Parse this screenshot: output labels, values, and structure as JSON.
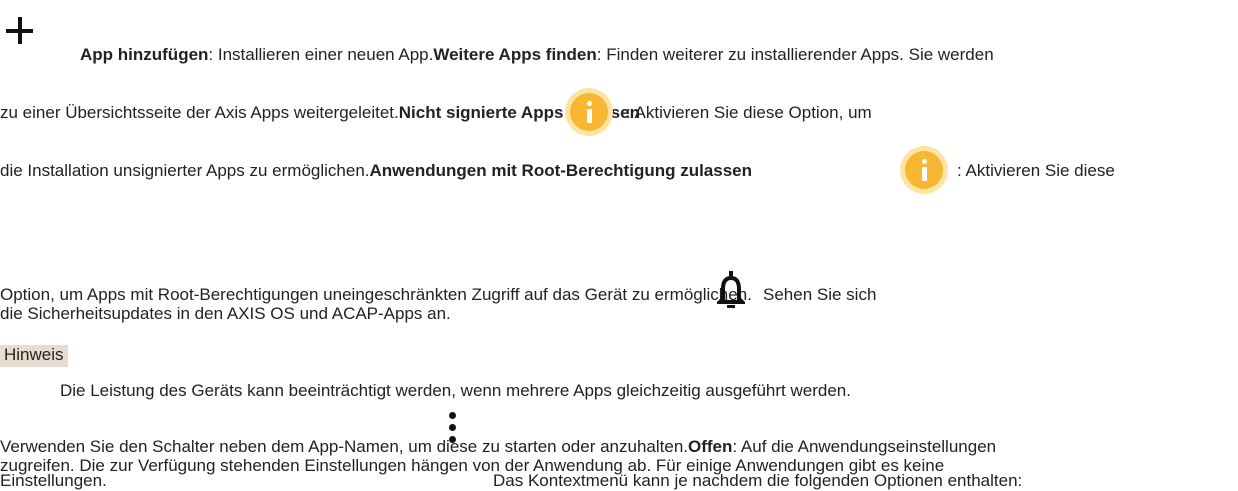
{
  "add_app": {
    "icon": "plus-icon",
    "label": "App hinzufügen",
    "desc": ": Installieren einer neuen App."
  },
  "find_apps": {
    "label": "Weitere Apps finden",
    "desc_line1": ": Finden weiterer zu installierender Apps. Sie werden",
    "desc_line2": "zu einer Übersichtsseite der Axis Apps weitergeleitet."
  },
  "unsigned_apps": {
    "label": "Nicht signierte Apps zulassen",
    "desc_line1": ": Aktivieren Sie diese Option, um",
    "desc_line2": "die Installation unsignierter Apps zu ermöglichen.",
    "icon": "info-icon"
  },
  "root_apps": {
    "label": "Anwendungen mit Root-Berechtigung zulassen",
    "desc_line1": ": Aktivieren Sie diese",
    "desc_line2": "Option, um Apps mit Root-Berechtigungen uneingeschränkten Zugriff auf das Gerät zu ermöglichen.",
    "icon": "info-icon"
  },
  "security_updates": {
    "icon": "bell-icon",
    "line1": "Sehen Sie sich",
    "line2": "die Sicherheitsupdates in den AXIS OS und ACAP-Apps an."
  },
  "note": {
    "label": "Hinweis",
    "text": "Die Leistung des Geräts kann beeinträchtigt werden, wenn mehrere Apps gleichzeitig ausgeführt werden."
  },
  "toggle_text": "Verwenden Sie den Schalter neben dem App-Namen, um diese zu starten oder anzuhalten.",
  "open": {
    "label": "Offen",
    "desc_line1": ": Auf die Anwendungseinstellungen",
    "desc_line2": "zugreifen. Die zur Verfügung stehenden Einstellungen hängen von der Anwendung ab. Für einige Anwendungen gibt es keine",
    "desc_line3": "Einstellungen."
  },
  "context_menu": {
    "icon": "kebab-menu-icon",
    "text": "Das Kontextmenü kann je nachdem die folgenden Optionen enthalten:"
  },
  "colors": {
    "info_icon": "#f7b733",
    "info_halo": "#fde4a3",
    "note_bg": "#e6ddd0"
  }
}
